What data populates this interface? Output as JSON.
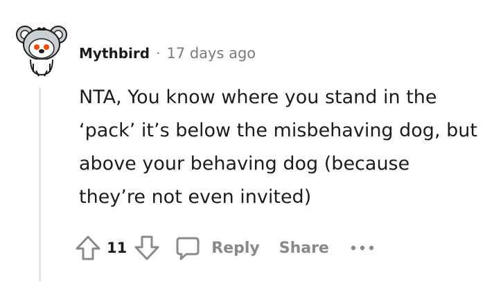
{
  "comment": {
    "username": "Mythbird",
    "separator": "·",
    "timestamp": "17 days ago",
    "body": "NTA, You know where you stand in the ‘pack’ it’s below the misbehaving dog, but above your behaving dog (because they’re not even invited)",
    "vote_count": "11",
    "reply_label": "Reply",
    "share_label": "Share"
  },
  "icons": {
    "avatar": "snoo-koala-avatar",
    "upvote": "arrow-up-outline-icon",
    "downvote": "arrow-down-outline-icon",
    "reply": "speech-bubble-icon",
    "more": "ellipsis-horizontal-icon"
  },
  "colors": {
    "text": "#1c1c1c",
    "muted": "#787c7e",
    "action": "#878a8c",
    "thread_line": "#e6e6e6",
    "avatar_accent": "#ff4500"
  }
}
